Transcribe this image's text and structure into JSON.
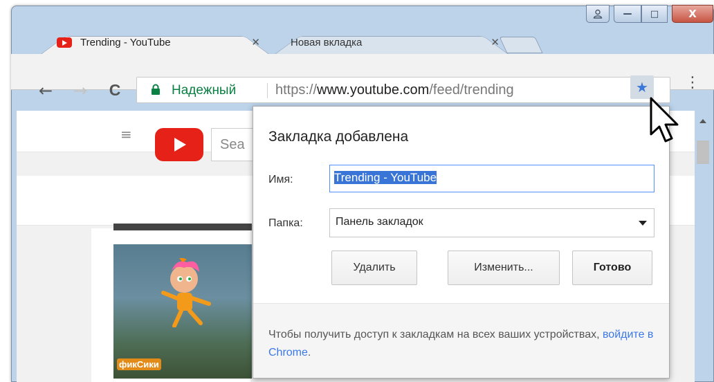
{
  "window": {
    "controls": {
      "user_icon": "user-icon",
      "minimize": "—",
      "maximize": "□",
      "close": "X"
    }
  },
  "tabs": [
    {
      "title": "Trending - YouTube",
      "close": "✕",
      "favicon": "youtube-icon"
    },
    {
      "title": "Новая вкладка",
      "close": "✕"
    }
  ],
  "toolbar": {
    "back": "←",
    "forward": "→",
    "reload": "C",
    "secure_label": "Надежный",
    "url_scheme": "https://",
    "url_host": "www.youtube.com",
    "url_path": "/feed/trending",
    "star": "★",
    "menu": "⋮"
  },
  "page": {
    "menu_icon": "≡",
    "search_placeholder": "Sea",
    "thumb_logo": "фикСики"
  },
  "bookmark_bubble": {
    "title": "Закладка добавлена",
    "name_label": "Имя:",
    "name_value": "Trending - YouTube",
    "folder_label": "Папка:",
    "folder_value": "Панель закладок",
    "remove_button": "Удалить",
    "edit_button": "Изменить...",
    "done_button": "Готово",
    "footer_text": "Чтобы получить доступ к закладкам на всех ваших устройствах, ",
    "footer_link": "войдите в Chrome",
    "footer_end": "."
  },
  "colors": {
    "accent": "#3b78e7",
    "secure": "#0b8043",
    "youtube_red": "#e62117",
    "close_button": "#c75544"
  }
}
